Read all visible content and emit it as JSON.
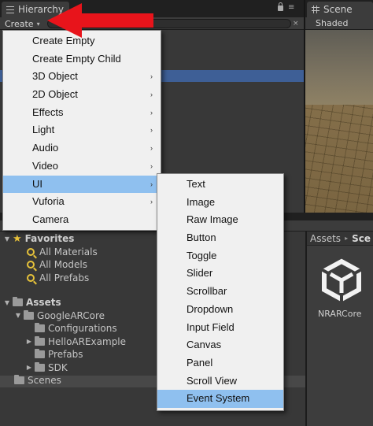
{
  "hierarchy": {
    "tab_label": "Hierarchy",
    "create_label": "Create",
    "create_caret": "▾",
    "menu_icon": "≡",
    "search_clear": "×",
    "icons": [
      "list-icon",
      "lock-icon",
      "menu-icon"
    ]
  },
  "scene": {
    "tab_label": "Scene",
    "shaded_label": "Shaded",
    "icons": [
      "hash-icon"
    ]
  },
  "create_menu": {
    "items": [
      {
        "label": "Create Empty",
        "submenu": false
      },
      {
        "label": "Create Empty Child",
        "submenu": false
      },
      {
        "label": "3D Object",
        "submenu": true
      },
      {
        "label": "2D Object",
        "submenu": true
      },
      {
        "label": "Effects",
        "submenu": true
      },
      {
        "label": "Light",
        "submenu": true
      },
      {
        "label": "Audio",
        "submenu": true
      },
      {
        "label": "Video",
        "submenu": true
      },
      {
        "label": "UI",
        "submenu": true,
        "active": true
      },
      {
        "label": "Vuforia",
        "submenu": true
      },
      {
        "label": "Camera",
        "submenu": false
      }
    ],
    "arrow_glyph": "›",
    "highlight_color": "#8fc0ef"
  },
  "ui_submenu": {
    "items": [
      "Text",
      "Image",
      "Raw Image",
      "Button",
      "Toggle",
      "Slider",
      "Scrollbar",
      "Dropdown",
      "Input Field",
      "Canvas",
      "Panel",
      "Scroll View",
      "Event System"
    ],
    "active_item": "Event System"
  },
  "project": {
    "favorites": {
      "label": "Favorites",
      "items": [
        "All Materials",
        "All Models",
        "All Prefabs"
      ]
    },
    "assets": {
      "label": "Assets",
      "google_arcore": {
        "label": "GoogleARCore",
        "children": [
          "Configurations",
          "HelloARExample",
          "Prefabs",
          "SDK"
        ]
      },
      "scenes": "Scenes"
    },
    "breadcrumb": {
      "root": "Assets",
      "separator": "▸",
      "current": "Sce"
    },
    "asset_tile": {
      "label": "NRARCore",
      "icon": "unity-logo"
    },
    "icons": [
      "star-icon",
      "search-icon",
      "folder-icon"
    ]
  },
  "colors": {
    "annotation_arrow": "#e8141b",
    "selection_blue": "#3e5f96",
    "star_yellow": "#e9c23a"
  }
}
